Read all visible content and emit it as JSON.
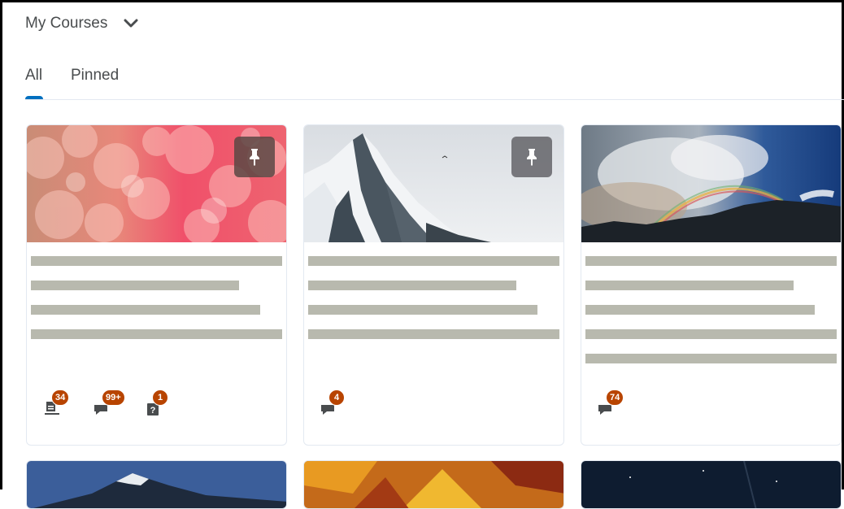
{
  "header": {
    "title": "My Courses",
    "dropdown_icon": "chevron-down-icon"
  },
  "tabs": [
    {
      "label": "All",
      "selected": true
    },
    {
      "label": "Pinned",
      "selected": false
    }
  ],
  "colors": {
    "accent": "#006fbf",
    "badge": "#b84400",
    "placeholder_bar": "#b8b9ae"
  },
  "cards": [
    {
      "image": "pink-bokeh-image",
      "pinned": true,
      "notifications": [
        {
          "icon": "assignment-icon",
          "count": "34"
        },
        {
          "icon": "discussion-icon",
          "count": "99+"
        },
        {
          "icon": "quiz-icon",
          "count": "1"
        }
      ]
    },
    {
      "image": "snowy-mountain-image",
      "pinned": true,
      "notifications": [
        {
          "icon": "discussion-icon",
          "count": "4"
        }
      ]
    },
    {
      "image": "rainbow-sky-image",
      "pinned": false,
      "notifications": [
        {
          "icon": "discussion-icon",
          "count": "74"
        }
      ]
    }
  ]
}
